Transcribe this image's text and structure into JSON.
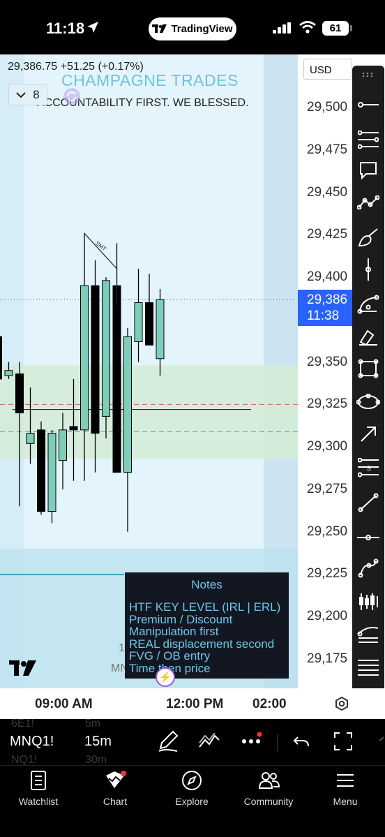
{
  "status_bar": {
    "time": "11:18",
    "app_pill": "TradingView",
    "battery": "61"
  },
  "chart": {
    "quote": "29,386.75 +51.25 (+0.17%)",
    "watermark_title": "CHAMPAGNE TRADES",
    "watermark_subtitle": "ACCOUNTABILITY FIRST. WE BLESSED.",
    "collapse_count": "8",
    "annotation_label": "SMT",
    "bg_text_1": "1",
    "bg_text_2": "MN",
    "colors": {
      "up": "#7ecdbb",
      "down": "#000000",
      "zone": "#d4ecd7",
      "current": "#2962ff"
    }
  },
  "chart_data": {
    "type": "candlestick",
    "symbol": "MNQ1!",
    "interval": "15m",
    "current_price": 29386.75,
    "ylim": [
      29150,
      29525
    ],
    "candles": [
      {
        "o": 29365,
        "h": 29385,
        "l": 29335,
        "c": 29340
      },
      {
        "o": 29342,
        "h": 29350,
        "l": 29340,
        "c": 29345
      },
      {
        "o": 29343,
        "h": 29350,
        "l": 29265,
        "c": 29320
      },
      {
        "o": 29302,
        "h": 29335,
        "l": 29290,
        "c": 29308
      },
      {
        "o": 29310,
        "h": 29315,
        "l": 29260,
        "c": 29262
      },
      {
        "o": 29262,
        "h": 29310,
        "l": 29255,
        "c": 29308
      },
      {
        "o": 29292,
        "h": 29320,
        "l": 29275,
        "c": 29310
      },
      {
        "o": 29312,
        "h": 29340,
        "l": 29280,
        "c": 29310
      },
      {
        "o": 29310,
        "h": 29425,
        "l": 29280,
        "c": 29395
      },
      {
        "o": 29395,
        "h": 29410,
        "l": 29285,
        "c": 29308
      },
      {
        "o": 29318,
        "h": 29400,
        "l": 29305,
        "c": 29398
      },
      {
        "o": 29395,
        "h": 29420,
        "l": 29290,
        "c": 29285
      },
      {
        "o": 29285,
        "h": 29370,
        "l": 29250,
        "c": 29365
      },
      {
        "o": 29362,
        "h": 29405,
        "l": 29350,
        "c": 29385
      },
      {
        "o": 29385,
        "h": 29402,
        "l": 29360,
        "c": 29360
      },
      {
        "o": 29352,
        "h": 29393,
        "l": 29342,
        "c": 29386.75
      }
    ],
    "levels": [
      {
        "price": 29325,
        "style": "dashed",
        "color": "#e05a5a"
      },
      {
        "price": 29322,
        "style": "solid",
        "color": "#111111"
      },
      {
        "price": 29309,
        "style": "dashed",
        "color": "#4aa8c0"
      },
      {
        "price": 29386.75,
        "style": "dotted",
        "color": "#2962ff"
      }
    ],
    "price_ticks": [
      "29,500",
      "29,475",
      "29,450",
      "29,425",
      "29,400",
      "29,350",
      "29,325",
      "29,300",
      "29,275",
      "29,250",
      "29,225",
      "29,200",
      "29,175"
    ],
    "time_ticks": [
      "09:00 AM",
      "12:00 PM",
      "02:00"
    ]
  },
  "price_axis": {
    "currency": "USD",
    "current_price": "29,386",
    "countdown": "11:38"
  },
  "notes": {
    "title": "Notes",
    "items": [
      "HTF KEY LEVEL (IRL | ERL)",
      "Premium / Discount",
      "Manipulation first",
      "REAL displacement second",
      "FVG / OB entry",
      "Time then price"
    ]
  },
  "symbol_bar": {
    "symbol": "MNQ1!",
    "interval": "15m",
    "ghost_above_symbol": "6E1!",
    "ghost_above_interval": "5m",
    "ghost_below_symbol": "NQ1!",
    "ghost_below_interval": "30m"
  },
  "bottom_nav": [
    {
      "label": "Watchlist",
      "icon": "watchlist-icon"
    },
    {
      "label": "Chart",
      "icon": "chart-icon"
    },
    {
      "label": "Explore",
      "icon": "compass-icon"
    },
    {
      "label": "Community",
      "icon": "community-icon"
    },
    {
      "label": "Menu",
      "icon": "menu-icon"
    }
  ]
}
